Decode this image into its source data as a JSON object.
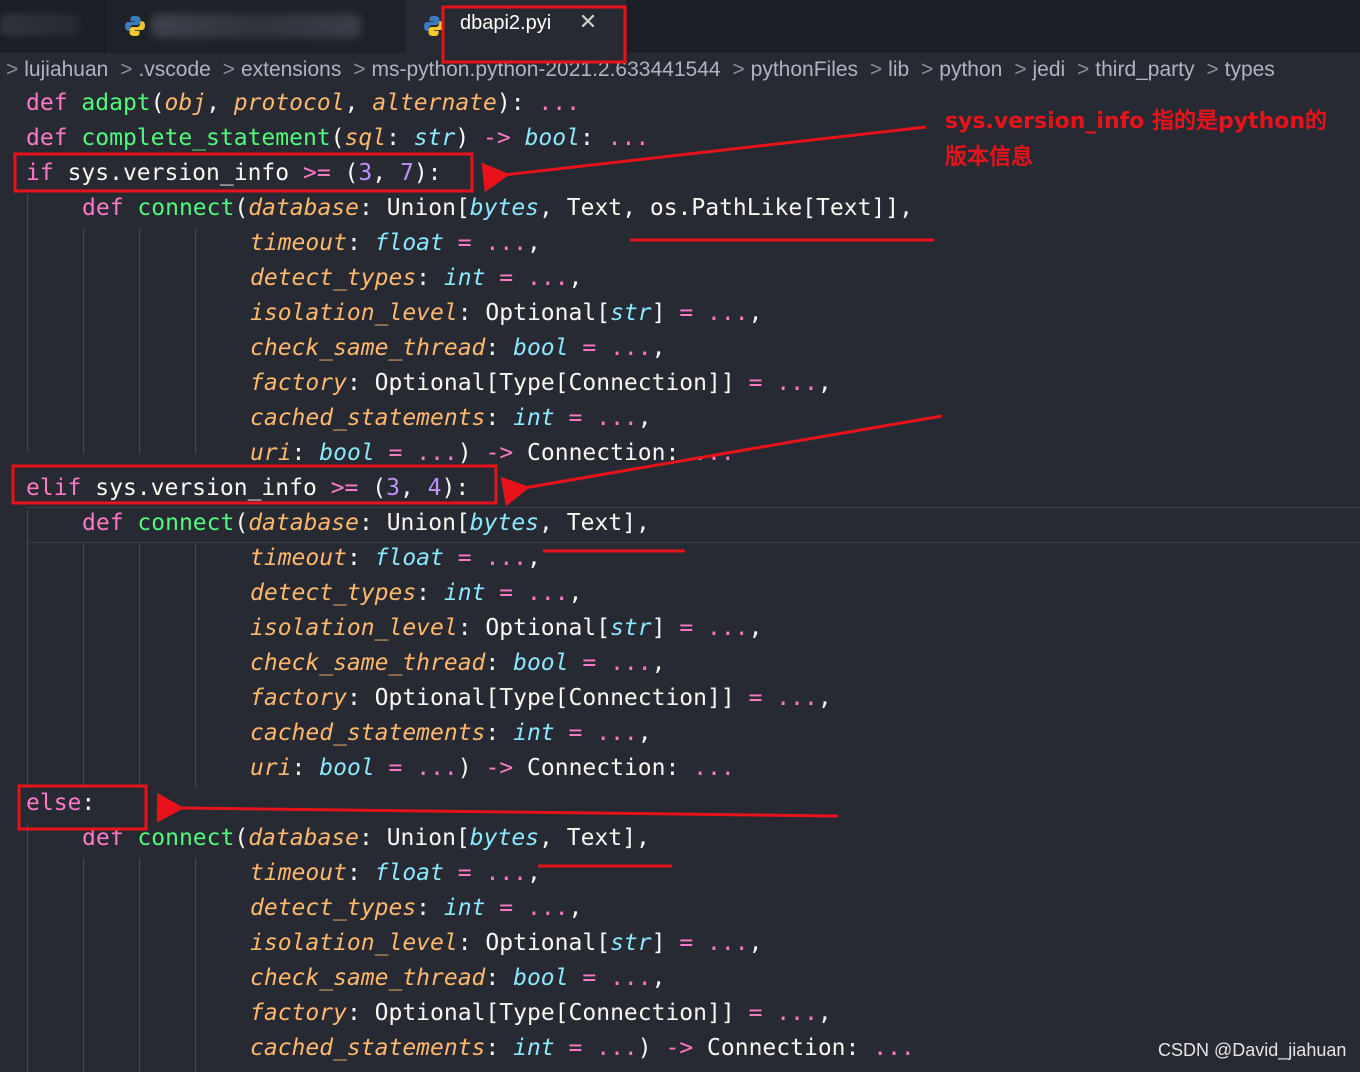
{
  "tabs": {
    "active_title": "dbapi2.pyi",
    "close_glyph": "✕"
  },
  "breadcrumb": [
    "lujiahuan",
    ".vscode",
    "extensions",
    "ms-python.python-2021.2.633441544",
    "pythonFiles",
    "lib",
    "python",
    "jedi",
    "third_party",
    "types"
  ],
  "breadcrumb_separator": ">",
  "code": {
    "l1": {
      "kw": "def",
      "fn": "adapt",
      "p1": "obj",
      "p2": "protocol",
      "p3": "alternate",
      "ell": "..."
    },
    "l2": {
      "kw": "def",
      "fn": "complete_statement",
      "p1": "sql",
      "t1": "str",
      "t2": "bool",
      "ell": "..."
    },
    "if_block": {
      "kw": "if",
      "cond": "sys.version_info",
      "nums": [
        "3",
        "7"
      ]
    },
    "elif_block": {
      "kw": "elif",
      "cond": "sys.version_info",
      "nums": [
        "3",
        "4"
      ]
    },
    "else_block": {
      "kw": "else"
    },
    "connect": {
      "kw": "def",
      "fn": "connect",
      "database": "database",
      "union": "Union",
      "bytes": "bytes",
      "text": "Text",
      "pathlike": "os.PathLike",
      "timeout": "timeout",
      "float": "float",
      "detect_types": "detect_types",
      "int": "int",
      "isolation_level": "isolation_level",
      "optional": "Optional",
      "str": "str",
      "check_same_thread": "check_same_thread",
      "bool": "bool",
      "factory": "factory",
      "type": "Type",
      "connection": "Connection",
      "cached_statements": "cached_statements",
      "uri": "uri",
      "ell": "..."
    }
  },
  "annotation": {
    "line1": "sys.version_info 指的是python的",
    "line2": "版本信息",
    "color": "#e8131a"
  },
  "watermark": "CSDN @David_jiahuan",
  "colors": {
    "keyword": "#ff79c6",
    "function": "#50fa7b",
    "param": "#ffb86c",
    "type": "#8be9fd",
    "number": "#bd93f9",
    "background": "#272a33"
  }
}
